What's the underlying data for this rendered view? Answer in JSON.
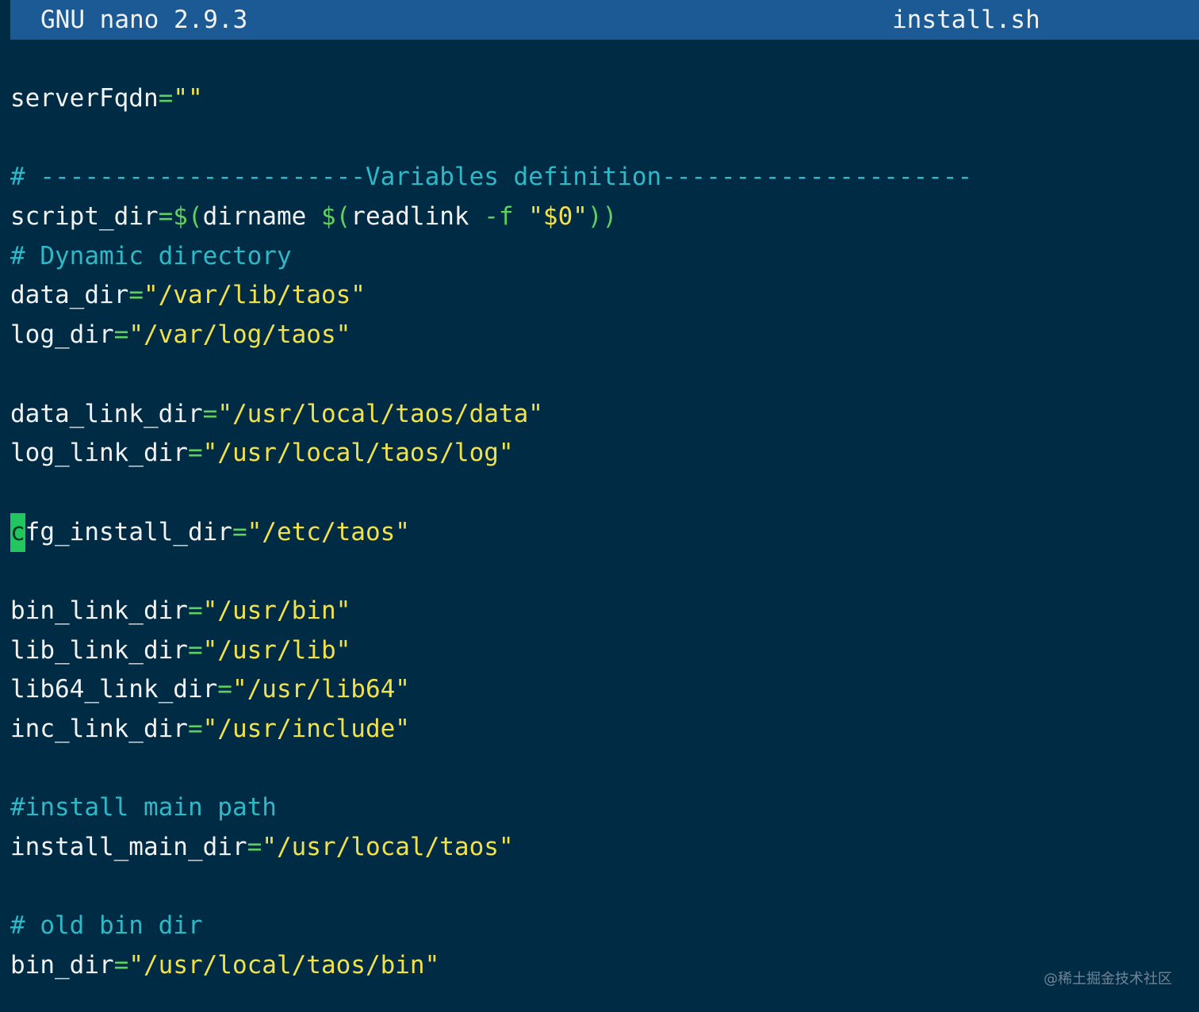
{
  "titlebar": {
    "app_name": "GNU nano 2.9.3",
    "file_name": "install.sh"
  },
  "editor": {
    "cursor_position": {
      "line": 11,
      "column": 1
    },
    "colors": {
      "background": "#002b45",
      "titlebar": "#1b5a94",
      "identifier": "#f2f2f2",
      "operator": "#5fd05f",
      "string": "#f2e24a",
      "comment": "#2fb8c6",
      "cursor": "#22c55e"
    },
    "lines": [
      [
        {
          "t": "serverFqdn",
          "c": "name"
        },
        {
          "t": "=",
          "c": "op"
        },
        {
          "t": "\"\"",
          "c": "str"
        }
      ],
      [],
      [
        {
          "t": "# ----------------------Variables definition---------------------",
          "c": "cmt"
        }
      ],
      [
        {
          "t": "script_dir",
          "c": "name"
        },
        {
          "t": "=$(",
          "c": "op"
        },
        {
          "t": "dirname ",
          "c": "name"
        },
        {
          "t": "$(",
          "c": "op"
        },
        {
          "t": "readlink ",
          "c": "name"
        },
        {
          "t": "-f ",
          "c": "op"
        },
        {
          "t": "\"$0\"",
          "c": "str"
        },
        {
          "t": "))",
          "c": "op"
        }
      ],
      [
        {
          "t": "# Dynamic directory",
          "c": "cmt"
        }
      ],
      [
        {
          "t": "data_dir",
          "c": "name"
        },
        {
          "t": "=",
          "c": "op"
        },
        {
          "t": "\"/var/lib/taos\"",
          "c": "str"
        }
      ],
      [
        {
          "t": "log_dir",
          "c": "name"
        },
        {
          "t": "=",
          "c": "op"
        },
        {
          "t": "\"/var/log/taos\"",
          "c": "str"
        }
      ],
      [],
      [
        {
          "t": "data_link_dir",
          "c": "name"
        },
        {
          "t": "=",
          "c": "op"
        },
        {
          "t": "\"/usr/local/taos/data\"",
          "c": "str"
        }
      ],
      [
        {
          "t": "log_link_dir",
          "c": "name"
        },
        {
          "t": "=",
          "c": "op"
        },
        {
          "t": "\"/usr/local/taos/log\"",
          "c": "str"
        }
      ],
      [],
      [
        {
          "t": "c",
          "c": "cursor"
        },
        {
          "t": "fg_install_dir",
          "c": "name"
        },
        {
          "t": "=",
          "c": "op"
        },
        {
          "t": "\"/etc/taos\"",
          "c": "str"
        }
      ],
      [],
      [
        {
          "t": "bin_link_dir",
          "c": "name"
        },
        {
          "t": "=",
          "c": "op"
        },
        {
          "t": "\"/usr/bin\"",
          "c": "str"
        }
      ],
      [
        {
          "t": "lib_link_dir",
          "c": "name"
        },
        {
          "t": "=",
          "c": "op"
        },
        {
          "t": "\"/usr/lib\"",
          "c": "str"
        }
      ],
      [
        {
          "t": "lib64_link_dir",
          "c": "name"
        },
        {
          "t": "=",
          "c": "op"
        },
        {
          "t": "\"/usr/lib64\"",
          "c": "str"
        }
      ],
      [
        {
          "t": "inc_link_dir",
          "c": "name"
        },
        {
          "t": "=",
          "c": "op"
        },
        {
          "t": "\"/usr/include\"",
          "c": "str"
        }
      ],
      [],
      [
        {
          "t": "#install main path",
          "c": "cmt"
        }
      ],
      [
        {
          "t": "install_main_dir",
          "c": "name"
        },
        {
          "t": "=",
          "c": "op"
        },
        {
          "t": "\"/usr/local/taos\"",
          "c": "str"
        }
      ],
      [],
      [
        {
          "t": "# old bin dir",
          "c": "cmt"
        }
      ],
      [
        {
          "t": "bin_dir",
          "c": "name"
        },
        {
          "t": "=",
          "c": "op"
        },
        {
          "t": "\"/usr/local/taos/bin\"",
          "c": "str"
        }
      ]
    ]
  },
  "watermark": "@稀土掘金技术社区"
}
